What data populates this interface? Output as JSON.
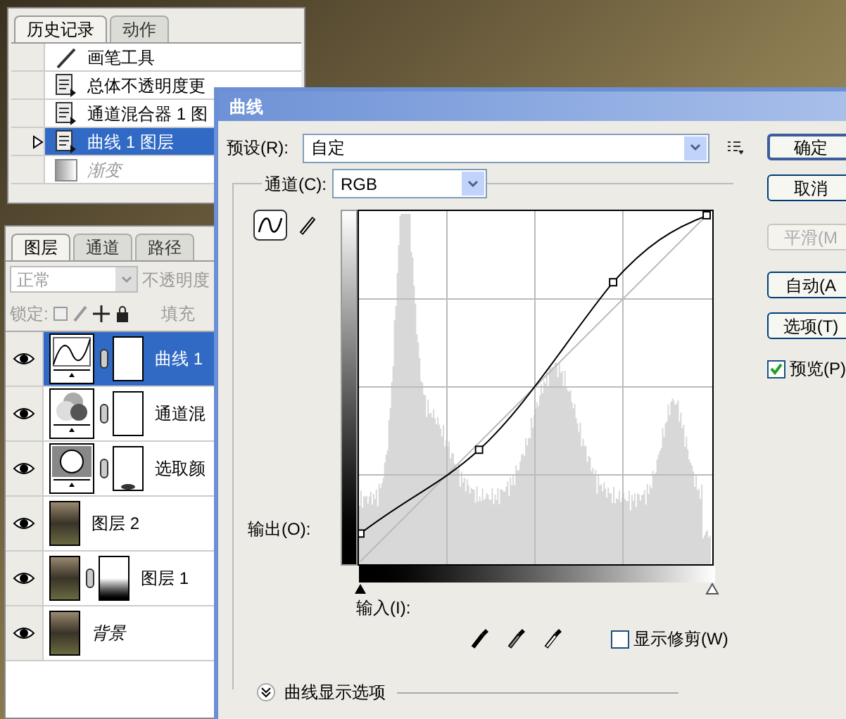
{
  "history_panel": {
    "tabs": [
      {
        "label": "历史记录",
        "selected": true
      },
      {
        "label": "动作",
        "selected": false
      }
    ],
    "items": [
      {
        "kind": "brush",
        "label": "画笔工具",
        "selected": false,
        "disabled": false
      },
      {
        "kind": "step",
        "label": "总体不透明度更",
        "selected": false,
        "disabled": false
      },
      {
        "kind": "step",
        "label": "通道混合器 1 图",
        "selected": false,
        "disabled": false
      },
      {
        "kind": "step",
        "label": "曲线 1 图层",
        "selected": true,
        "disabled": false
      },
      {
        "kind": "gradient",
        "label": "渐变",
        "selected": false,
        "disabled": true
      }
    ]
  },
  "layers_panel": {
    "tabs": [
      {
        "label": "图层",
        "selected": true
      },
      {
        "label": "通道",
        "selected": false
      },
      {
        "label": "路径",
        "selected": false
      }
    ],
    "blend_mode": "正常",
    "opacity_label": "不透明度",
    "lock_label": "锁定:",
    "fill_label": "填充",
    "layers": [
      {
        "kind": "curves",
        "name": "曲线 1",
        "masked": true,
        "selected": true,
        "visible": true
      },
      {
        "kind": "mixer",
        "name": "通道混",
        "masked": true,
        "selected": false,
        "visible": true
      },
      {
        "kind": "selective",
        "name": "选取颜",
        "masked": true,
        "selected": false,
        "visible": true
      },
      {
        "kind": "photo",
        "name": "图层 2",
        "masked": false,
        "selected": false,
        "visible": true
      },
      {
        "kind": "photo",
        "name": "图层 1",
        "masked": true,
        "selected": false,
        "visible": true
      },
      {
        "kind": "background",
        "name": "背景",
        "masked": false,
        "selected": false,
        "visible": true
      }
    ]
  },
  "dialog": {
    "title": "曲线",
    "preset_label": "预设(R):",
    "preset_value": "自定",
    "channel_label": "通道(C):",
    "channel_value": "RGB",
    "tools": [
      {
        "kind": "curve",
        "selected": true
      },
      {
        "kind": "pencil",
        "selected": false
      }
    ],
    "output_label": "输出(O):",
    "input_label": "输入(I):",
    "show_clipping": {
      "label": "显示修剪(W)",
      "checked": false
    },
    "display_options": "曲线显示选项",
    "buttons": [
      {
        "label": "确定",
        "disabled": false,
        "primary": true
      },
      {
        "label": "取消",
        "disabled": false,
        "primary": false
      },
      {
        "label": "平滑(M",
        "disabled": true,
        "primary": false
      },
      {
        "label": "自动(A",
        "disabled": false,
        "primary": false
      },
      {
        "label": "选项(T)",
        "disabled": false,
        "primary": false
      }
    ],
    "preview": {
      "label": "预览(P)",
      "checked": true
    }
  }
}
